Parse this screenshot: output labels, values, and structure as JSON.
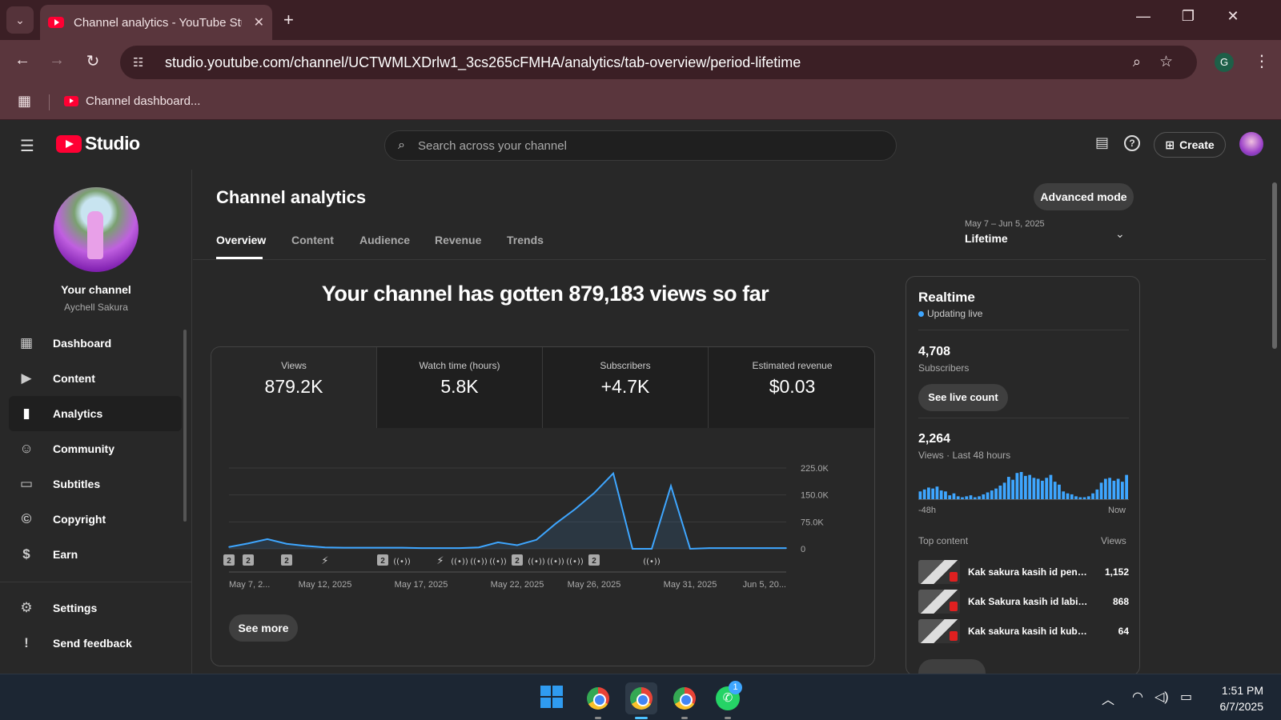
{
  "browser": {
    "tab_title": "Channel analytics - YouTube Stu",
    "url": "studio.youtube.com/channel/UCTWMLXDrlw1_3cs265cFMHA/analytics/tab-overview/period-lifetime",
    "profile_initial": "G",
    "bookmark_label": "Channel dashboard..."
  },
  "header": {
    "logo_text": "Studio",
    "search_placeholder": "Search across your channel",
    "create_label": "Create"
  },
  "sidebar": {
    "your_channel": "Your channel",
    "channel_name": "Aychell Sakura",
    "items": [
      {
        "label": "Dashboard",
        "icon": "dashboard-icon"
      },
      {
        "label": "Content",
        "icon": "content-icon"
      },
      {
        "label": "Analytics",
        "icon": "analytics-icon"
      },
      {
        "label": "Community",
        "icon": "community-icon"
      },
      {
        "label": "Subtitles",
        "icon": "subtitles-icon"
      },
      {
        "label": "Copyright",
        "icon": "copyright-icon"
      },
      {
        "label": "Earn",
        "icon": "earn-icon"
      }
    ],
    "footer_items": [
      {
        "label": "Settings",
        "icon": "settings-icon"
      },
      {
        "label": "Send feedback",
        "icon": "feedback-icon"
      }
    ]
  },
  "main": {
    "title": "Channel analytics",
    "advanced_mode": "Advanced mode",
    "tabs": [
      "Overview",
      "Content",
      "Audience",
      "Revenue",
      "Trends"
    ],
    "period_range": "May 7 – Jun 5, 2025",
    "period_label": "Lifetime",
    "headline": "Your channel has gotten 879,183 views so far",
    "metrics": [
      {
        "label": "Views",
        "value": "879.2K"
      },
      {
        "label": "Watch time (hours)",
        "value": "5.8K"
      },
      {
        "label": "Subscribers",
        "value": "+4.7K"
      },
      {
        "label": "Estimated revenue",
        "value": "$0.03"
      }
    ],
    "see_more": "See more"
  },
  "chart_data": {
    "type": "area",
    "x": [
      "May 7",
      "May 8",
      "May 9",
      "May 10",
      "May 11",
      "May 12",
      "May 13",
      "May 14",
      "May 15",
      "May 16",
      "May 17",
      "May 18",
      "May 19",
      "May 20",
      "May 21",
      "May 22",
      "May 23",
      "May 24",
      "May 25",
      "May 26",
      "May 27",
      "May 28",
      "May 29",
      "May 30",
      "May 31",
      "Jun 1",
      "Jun 2",
      "Jun 3",
      "Jun 4",
      "Jun 5"
    ],
    "values": [
      5000,
      15000,
      27000,
      14000,
      8000,
      4000,
      3000,
      3000,
      3000,
      3000,
      2000,
      2000,
      2000,
      4000,
      18000,
      10000,
      25000,
      70000,
      110000,
      155000,
      210000,
      0,
      0,
      175000,
      0,
      2000,
      2000,
      2000,
      2000,
      2000
    ],
    "tick_labels": [
      "May 7, 2...",
      "May 12, 2025",
      "May 17, 2025",
      "May 22, 2025",
      "May 26, 2025",
      "May 31, 2025",
      "Jun 5, 20..."
    ],
    "tick_positions": [
      0,
      5,
      10,
      15,
      19,
      24,
      29
    ],
    "y_ticks": [
      "0",
      "75.0K",
      "150.0K",
      "225.0K"
    ],
    "ylim": [
      0,
      225000
    ],
    "color": "#3ea6ff",
    "marker_types": [
      "2",
      "2",
      "2",
      "short",
      "2",
      "live",
      "short",
      "live",
      "live",
      "live",
      "2",
      "live",
      "live",
      "live",
      "2",
      "live"
    ],
    "marker_days": [
      0,
      1,
      3,
      5,
      8,
      9,
      11,
      12,
      13,
      14,
      15,
      16,
      17,
      18,
      19,
      22
    ]
  },
  "realtime": {
    "title": "Realtime",
    "status": "Updating live",
    "subscribers": "4,708",
    "subscribers_label": "Subscribers",
    "live_count_button": "See live count",
    "views": "2,264",
    "views_label": "Views · Last 48 hours",
    "bars": [
      8,
      10,
      12,
      11,
      13,
      9,
      8,
      4,
      6,
      3,
      2,
      3,
      4,
      2,
      3,
      5,
      7,
      9,
      11,
      14,
      17,
      23,
      20,
      27,
      28,
      24,
      25,
      22,
      21,
      19,
      22,
      25,
      18,
      15,
      8,
      6,
      5,
      3,
      2,
      2,
      3,
      6,
      10,
      17,
      21,
      22,
      19,
      21,
      18,
      25
    ],
    "axis_left": "-48h",
    "axis_right": "Now",
    "top_content_label": "Top content",
    "views_col_label": "Views",
    "top_content": [
      {
        "title": "Kak sakura kasih id penja...",
        "views": "1,152"
      },
      {
        "title": "Kak Sakura kasih id labirin ...",
        "views": "868"
      },
      {
        "title": "Kak sakura kasih id kuburan ...",
        "views": "64"
      }
    ]
  },
  "taskbar": {
    "whatsapp_badge": "1",
    "time": "1:51 PM",
    "date": "6/7/2025"
  }
}
